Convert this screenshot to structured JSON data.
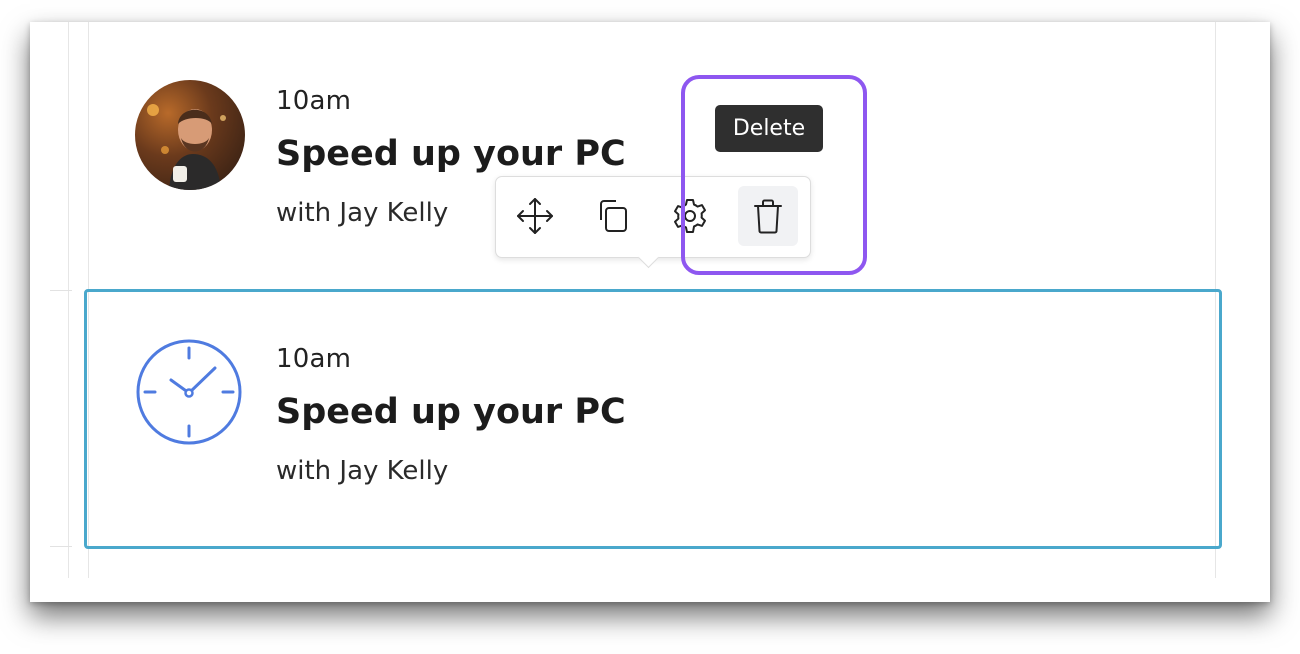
{
  "events": [
    {
      "time": "10am",
      "title": "Speed up your PC",
      "host": "with Jay Kelly",
      "icon": "avatar"
    },
    {
      "time": "10am",
      "title": "Speed up your PC",
      "host": "with Jay Kelly",
      "icon": "clock-icon"
    }
  ],
  "toolbar": {
    "items": [
      {
        "icon": "move-icon"
      },
      {
        "icon": "copy-icon"
      },
      {
        "icon": "settings-gear-icon"
      },
      {
        "icon": "trash-icon"
      }
    ],
    "tooltip": "Delete"
  },
  "colors": {
    "selected_border": "#4aa8cc",
    "highlight_border": "#8e57f0",
    "clock_stroke": "#4f7be0",
    "tooltip_bg": "#2f2f2f"
  }
}
